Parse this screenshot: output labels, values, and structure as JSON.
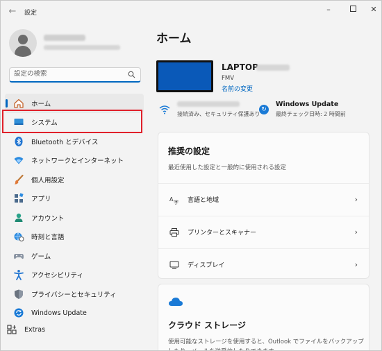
{
  "window": {
    "title": "設定",
    "back_icon": "arrow-left-icon",
    "minimize_icon": "minimize-icon",
    "maximize_icon": "maximize-icon",
    "close_icon": "close-icon"
  },
  "sidebar": {
    "search": {
      "placeholder": "設定の検索",
      "value": "",
      "icon": "search-icon"
    },
    "items": [
      {
        "label": "ホーム",
        "icon": "home-icon",
        "active": true
      },
      {
        "label": "システム",
        "icon": "display-icon",
        "active": false
      },
      {
        "label": "Bluetooth とデバイス",
        "icon": "bluetooth-icon",
        "active": false
      },
      {
        "label": "ネットワークとインターネット",
        "icon": "wifi-icon",
        "active": false
      },
      {
        "label": "個人用設定",
        "icon": "brush-icon",
        "active": false
      },
      {
        "label": "アプリ",
        "icon": "apps-icon",
        "active": false
      },
      {
        "label": "アカウント",
        "icon": "person-icon",
        "active": false
      },
      {
        "label": "時刻と言語",
        "icon": "globe-clock-icon",
        "active": false
      },
      {
        "label": "ゲーム",
        "icon": "gamepad-icon",
        "active": false
      },
      {
        "label": "アクセシビリティ",
        "icon": "accessibility-icon",
        "active": false
      },
      {
        "label": "プライバシーとセキュリティ",
        "icon": "shield-icon",
        "active": false
      },
      {
        "label": "Windows Update",
        "icon": "update-icon",
        "active": false
      }
    ],
    "extras": {
      "label": "Extras",
      "icon": "extras-icon"
    }
  },
  "main": {
    "title": "ホーム",
    "device": {
      "name": "LAPTOP-",
      "model": "FMV",
      "rename_link": "名前の変更"
    },
    "status": {
      "network_sub": "接続済み、セキュリティ保護あり",
      "update_title": "Windows Update",
      "update_sub": "最終チェック日時: 2 時間前"
    },
    "recommended": {
      "title": "推奨の設定",
      "desc": "最近使用した設定と一般的に使用される設定",
      "rows": [
        {
          "label": "言語と地域",
          "icon": "language-icon"
        },
        {
          "label": "プリンターとスキャナー",
          "icon": "printer-icon"
        },
        {
          "label": "ディスプレイ",
          "icon": "monitor-icon"
        }
      ]
    },
    "cloud": {
      "title": "クラウド ストレージ",
      "desc": "使用可能なストレージを使用すると、Outlook でファイルをバックアップしたり、メールを送受信したりできます",
      "icon": "cloud-icon"
    }
  },
  "colors": {
    "accent": "#0067c0",
    "highlight": "#e0202a",
    "device_screen": "#0a59b8"
  }
}
